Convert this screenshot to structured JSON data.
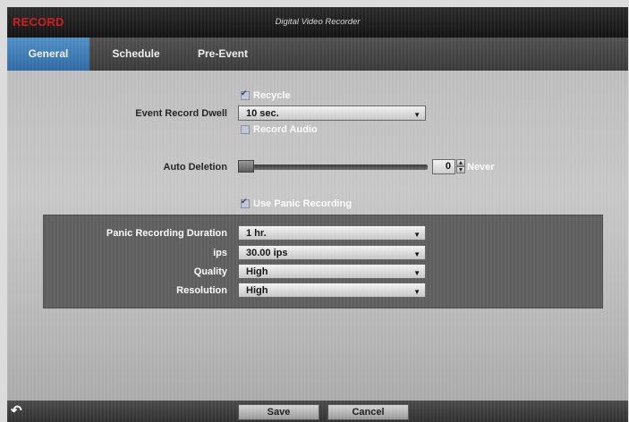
{
  "titlebar": {
    "app_name": "RECORD",
    "window_title": "Digital Video Recorder"
  },
  "tabs": [
    {
      "label": "General",
      "active": true
    },
    {
      "label": "Schedule",
      "active": false
    },
    {
      "label": "Pre-Event",
      "active": false
    }
  ],
  "general": {
    "recycle": {
      "label": "Recycle",
      "checked": true
    },
    "event_record_dwell": {
      "label": "Event Record Dwell",
      "value": "10 sec."
    },
    "record_audio": {
      "label": "Record Audio",
      "checked": false
    },
    "auto_deletion": {
      "label": "Auto Deletion",
      "value": "0",
      "unit_label": "Never",
      "fraction": 0.0
    },
    "use_panic_recording": {
      "label": "Use Panic Recording",
      "checked": true
    }
  },
  "panic_panel": {
    "duration": {
      "label": "Panic Recording Duration",
      "value": "1 hr."
    },
    "ips": {
      "label": "ips",
      "value": "30.00 ips"
    },
    "quality": {
      "label": "Quality",
      "value": "High"
    },
    "resolution": {
      "label": "Resolution",
      "value": "High"
    }
  },
  "footer": {
    "save_label": "Save",
    "cancel_label": "Cancel",
    "back_icon": "back-arrow-icon"
  },
  "icons": {
    "dropdown": "▼",
    "spin_up": "▲",
    "spin_down": "▼",
    "back": "↶"
  },
  "colors": {
    "accent_tab": "#3a7ab8",
    "app_name": "#d61a1a"
  }
}
